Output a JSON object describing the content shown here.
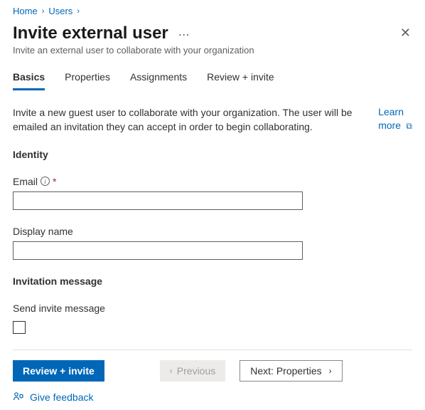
{
  "breadcrumb": {
    "home": "Home",
    "users": "Users"
  },
  "header": {
    "title": "Invite external user",
    "subtitle": "Invite an external user to collaborate with your organization"
  },
  "tabs": {
    "basics": "Basics",
    "properties": "Properties",
    "assignments": "Assignments",
    "review": "Review + invite"
  },
  "intro": {
    "text": "Invite a new guest user to collaborate with your organization. The user will be emailed an invitation they can accept in order to begin collaborating.",
    "learn": "Learn",
    "more": "more"
  },
  "sections": {
    "identity": "Identity",
    "invitation": "Invitation message"
  },
  "fields": {
    "email_label": "Email",
    "email_value": "",
    "required": "*",
    "display_label": "Display name",
    "display_value": "",
    "send_invite_label": "Send invite message"
  },
  "footer": {
    "review": "Review + invite",
    "previous": "Previous",
    "next": "Next: Properties",
    "feedback": "Give feedback"
  }
}
